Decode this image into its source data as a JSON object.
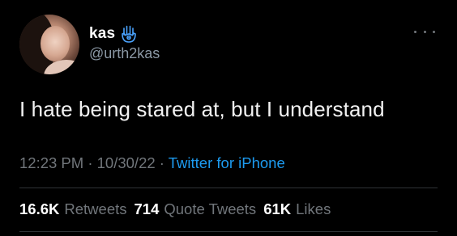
{
  "author": {
    "display_name": "kas",
    "handle": "@urth2kas",
    "badge_icon": "hamsa-icon",
    "badge_color": "#4aa3ff"
  },
  "tweet": {
    "text": "I hate being stared at, but I understand",
    "time": "12:23 PM",
    "date": "10/30/22",
    "source": "Twitter for iPhone",
    "separator": "·"
  },
  "stats": {
    "retweets_count": "16.6K",
    "retweets_label": "Retweets",
    "quote_count": "714",
    "quote_label": "Quote Tweets",
    "likes_count": "61K",
    "likes_label": "Likes"
  },
  "colors": {
    "background": "#000000",
    "text_primary": "#e7e9ea",
    "text_secondary": "#71767b",
    "link": "#1d9bf0"
  },
  "menu_icon": "more-horizontal-icon"
}
